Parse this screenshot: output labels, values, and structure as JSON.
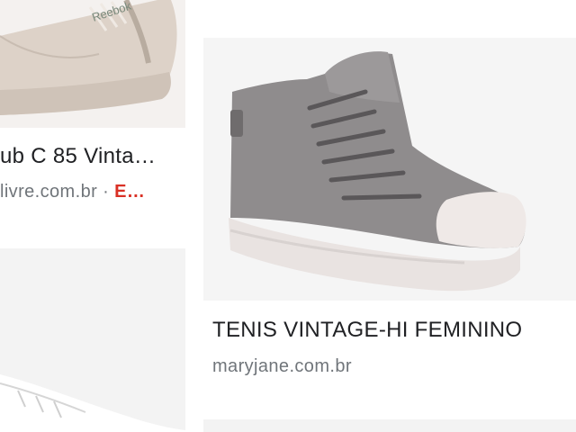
{
  "results": [
    {
      "title": "ub C 85 Vinta…",
      "source": "livre.com.br",
      "separator": "·",
      "badge": "E…",
      "image": "sneaker-reebok-club-c-85-vintage-image"
    },
    {
      "title": "TENIS VINTAGE-HI FEMININO",
      "source": "maryjane.com.br",
      "image": "sneaker-grey-high-top-image"
    },
    {
      "image": "sneaker-white-image"
    },
    {
      "image": "result-image"
    }
  ]
}
